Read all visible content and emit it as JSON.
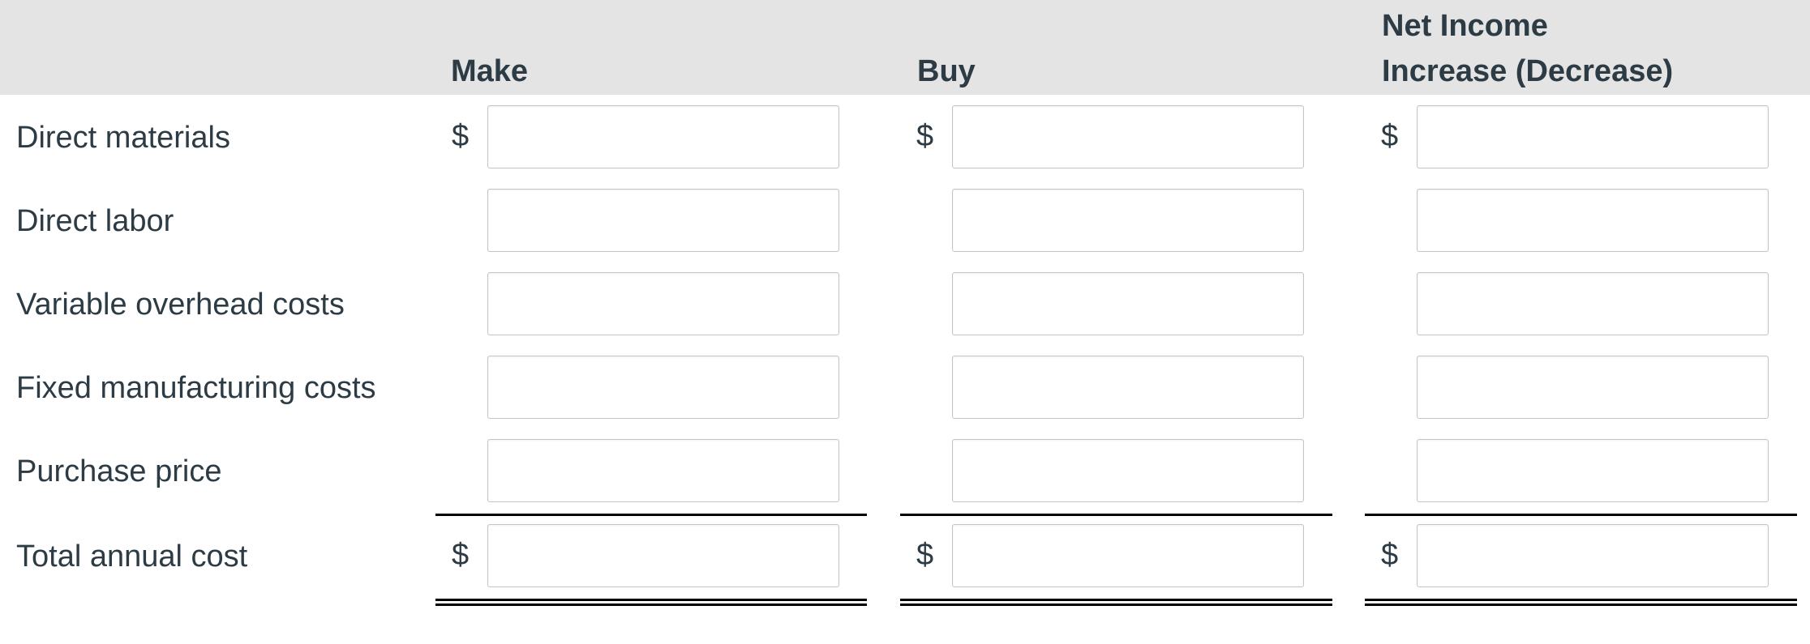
{
  "columns": {
    "make": "Make",
    "buy": "Buy",
    "net_income_line1": "Net Income",
    "net_income_line2": "Increase (Decrease)"
  },
  "currency_symbol": "$",
  "rows": [
    {
      "label": "Direct materials",
      "make": "",
      "buy": "",
      "net": ""
    },
    {
      "label": "Direct labor",
      "make": "",
      "buy": "",
      "net": ""
    },
    {
      "label": "Variable overhead costs",
      "make": "",
      "buy": "",
      "net": ""
    },
    {
      "label": "Fixed manufacturing costs",
      "make": "",
      "buy": "",
      "net": ""
    },
    {
      "label": "Purchase price",
      "make": "",
      "buy": "",
      "net": ""
    }
  ],
  "total": {
    "label": "Total annual cost",
    "make": "",
    "buy": "",
    "net": ""
  }
}
